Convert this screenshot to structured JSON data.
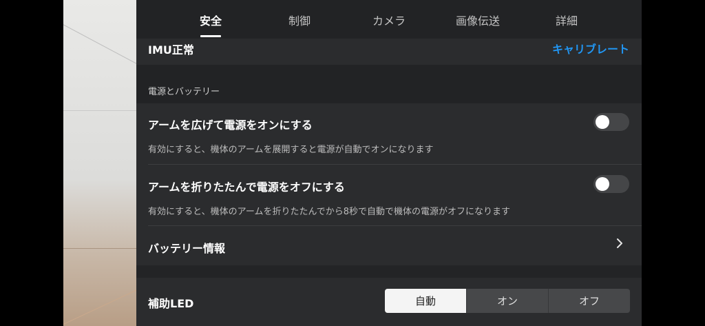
{
  "tabs": [
    {
      "label": "安全",
      "active": true
    },
    {
      "label": "制御",
      "active": false
    },
    {
      "label": "カメラ",
      "active": false
    },
    {
      "label": "画像伝送",
      "active": false
    },
    {
      "label": "詳細",
      "active": false
    }
  ],
  "imu": {
    "status": "IMU正常",
    "calibrate_link": "キャリブレート"
  },
  "power_section": {
    "header": "電源とバッテリー",
    "unfold_power_on": {
      "title": "アームを広げて電源をオンにする",
      "description": "有効にすると、機体のアームを展開すると電源が自動でオンになります",
      "enabled": false
    },
    "fold_power_off": {
      "title": "アームを折りたたんで電源をオフにする",
      "description": "有効にすると、機体のアームを折りたたんでから8秒で自動で機体の電源がオフになります",
      "enabled": false
    },
    "battery_info": {
      "title": "バッテリー情報",
      "icon": "chevron-right-icon"
    }
  },
  "aux_led": {
    "label": "補助LED",
    "options": [
      "自動",
      "オン",
      "オフ"
    ],
    "selected": "自動"
  },
  "colors": {
    "accent": "#2196f3",
    "panel_bg": "#2b2c2e",
    "toggle_off": "#454648"
  }
}
